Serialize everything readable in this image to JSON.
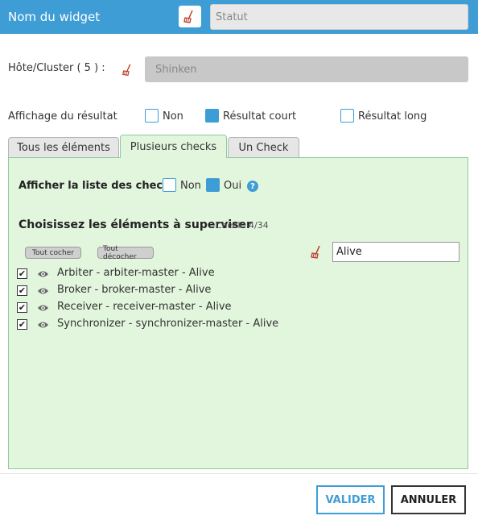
{
  "header": {
    "title": "Nom du widget",
    "widget_name_value": "Statut"
  },
  "host": {
    "label": "Hôte/Cluster ( 5 ) :",
    "value": "Shinken"
  },
  "display": {
    "label": "Affichage du résultat",
    "options": [
      {
        "label": "Non",
        "checked": false
      },
      {
        "label": "Résultat court",
        "checked": true
      },
      {
        "label": "Résultat long",
        "checked": false
      }
    ]
  },
  "tabs": [
    {
      "label": "Tous les éléments",
      "active": false
    },
    {
      "label": "Plusieurs checks",
      "active": true
    },
    {
      "label": "Un Check",
      "active": false
    }
  ],
  "panel": {
    "show_list_label": "Afficher la liste des checks",
    "show_list_options": [
      {
        "label": "Non",
        "checked": false
      },
      {
        "label": "Oui",
        "checked": true
      }
    ],
    "help_icon": "?",
    "choose_label": "Choisissez les éléments à superviser",
    "check_count": "Check: 4/34",
    "check_all_label": "Tout cocher",
    "uncheck_all_label": "Tout décocher",
    "filter_value": "Alive",
    "items": [
      {
        "label": "Arbiter - arbiter-master - Alive",
        "checked": true
      },
      {
        "label": "Broker - broker-master - Alive",
        "checked": true
      },
      {
        "label": "Receiver - receiver-master - Alive",
        "checked": true
      },
      {
        "label": "Synchronizer - synchronizer-master - Alive",
        "checked": true
      }
    ]
  },
  "footer": {
    "validate_label": "VALIDER",
    "cancel_label": "ANNULER"
  },
  "colors": {
    "accent": "#3f9dd6",
    "panel_bg": "#e2f5dd",
    "broom": "#c0392b"
  },
  "icons": {
    "broom": "broom-icon",
    "eye": "eye-icon",
    "help": "help-icon"
  }
}
